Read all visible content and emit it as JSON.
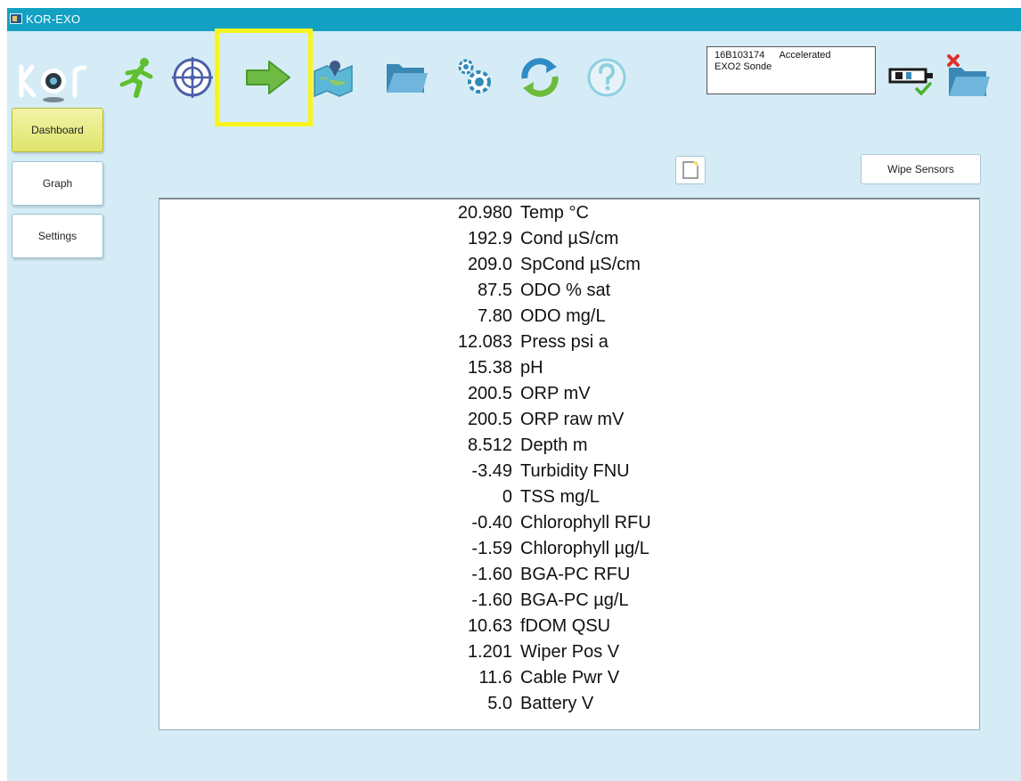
{
  "window": {
    "title": "KOR-EXO"
  },
  "toolbar": {
    "logo_text": "KOR",
    "icons": [
      "run-icon",
      "calibrate-icon",
      "deploy-icon",
      "sites-icon",
      "data-icon",
      "options-icon",
      "sync-icon",
      "help-icon"
    ]
  },
  "device": {
    "serial": "16B103174",
    "mode": "Accelerated",
    "name": "EXO2 Sonde"
  },
  "sidebar": {
    "items": [
      {
        "label": "Dashboard",
        "active": true
      },
      {
        "label": "Graph",
        "active": false
      },
      {
        "label": "Settings",
        "active": false
      }
    ]
  },
  "actions": {
    "wipe_label": "Wipe Sensors"
  },
  "readings": [
    {
      "value": "20.980",
      "label": "Temp °C"
    },
    {
      "value": "192.9",
      "label": "Cond µS/cm"
    },
    {
      "value": "209.0",
      "label": "SpCond µS/cm"
    },
    {
      "value": "87.5",
      "label": "ODO % sat"
    },
    {
      "value": "7.80",
      "label": "ODO mg/L"
    },
    {
      "value": "12.083",
      "label": "Press psi a"
    },
    {
      "value": "15.38",
      "label": "pH"
    },
    {
      "value": "200.5",
      "label": "ORP mV"
    },
    {
      "value": "200.5",
      "label": "ORP raw mV"
    },
    {
      "value": "8.512",
      "label": "Depth m"
    },
    {
      "value": "-3.49",
      "label": "Turbidity FNU"
    },
    {
      "value": "0",
      "label": "TSS mg/L"
    },
    {
      "value": "-0.40",
      "label": "Chlorophyll RFU"
    },
    {
      "value": "-1.59",
      "label": "Chlorophyll µg/L"
    },
    {
      "value": "-1.60",
      "label": "BGA-PC RFU"
    },
    {
      "value": "-1.60",
      "label": "BGA-PC µg/L"
    },
    {
      "value": "10.63",
      "label": "fDOM QSU"
    },
    {
      "value": "1.201",
      "label": "Wiper Pos V"
    },
    {
      "value": "11.6",
      "label": "Cable Pwr V"
    },
    {
      "value": "5.0",
      "label": "Battery V"
    }
  ],
  "colors": {
    "titlebar": "#12a0c3",
    "background": "#d5ecf6",
    "highlight": "#f7f41f",
    "active_tab": "#dfe46b"
  }
}
